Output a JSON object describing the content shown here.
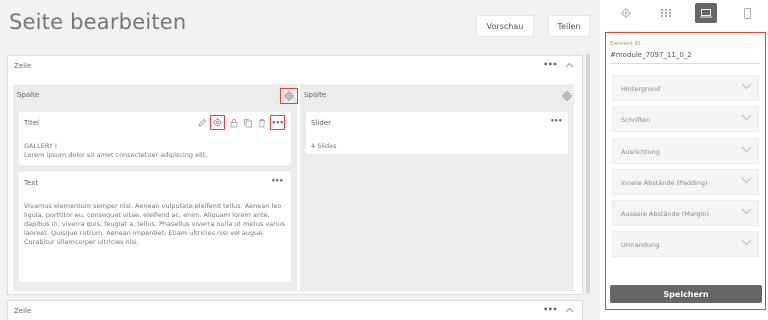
{
  "page": {
    "title": "Seite bearbeiten"
  },
  "header": {
    "preview_label": "Vorschau",
    "share_label": "Teilen"
  },
  "row1": {
    "label": "Zeile",
    "col1": {
      "label": "Spalte",
      "module_titel": {
        "label": "Titel",
        "line1": "GALLERY I",
        "line2": "Lorem ipsum dolor sit amet consectetuer adipiscing elit."
      },
      "module_text": {
        "label": "Text",
        "body": "Vivamus elementum semper nisi. Aenean vulputate eleifend tellus. Aenean leo ligula, porttitor eu, consequat vitae, eleifend ac, enim. Aliquam lorem ante, dapibus in, viverra quis, feugiat a, tellus. Phasellus viverra nulla ut metus varius laoreet. Quisque rutrum. Aenean imperdiet. Etiam ultricies nisi vel augue. Curabitur ullamcorper ultricies nisi."
      }
    },
    "col2": {
      "label": "Spalte",
      "module_slider": {
        "label": "Slider",
        "info": "4 Slides"
      }
    }
  },
  "row2": {
    "label": "Zeile"
  },
  "panel": {
    "device_tabs": [
      "settings-icon",
      "grid-icon",
      "desktop-icon",
      "mobile-icon"
    ],
    "active_tab": "desktop",
    "element_id_label": "Element ID",
    "element_id_value": "#module_7097_11_0_2",
    "sections": [
      "Hintergrund",
      "Schriften",
      "Ausrichtung",
      "Innere Abstände (Padding)",
      "Aussere Abstände (Margin)",
      "Umrandung"
    ],
    "save_label": "Speichern"
  },
  "colors": {
    "highlight": "#e2463b",
    "save_bg": "#666666",
    "active_tab_bg": "#666666"
  }
}
